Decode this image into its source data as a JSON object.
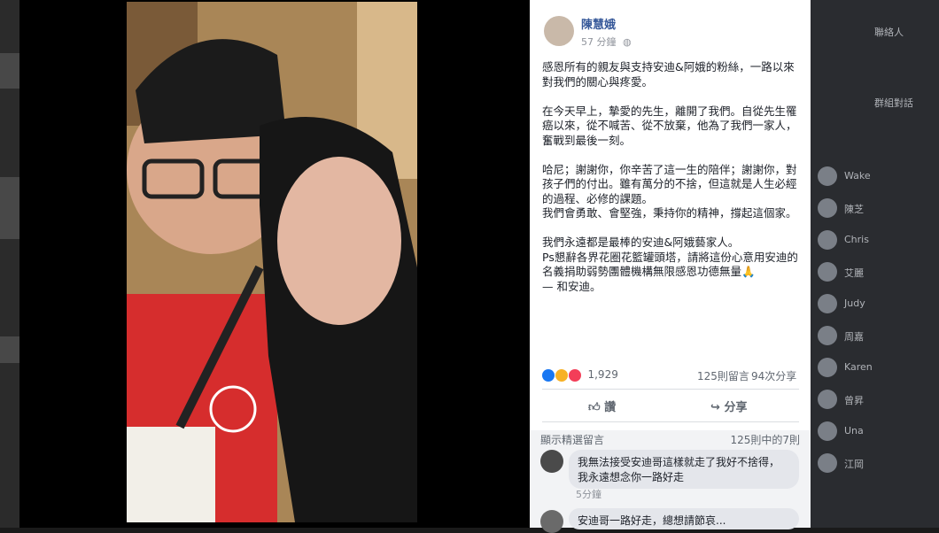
{
  "post": {
    "author": "陳慧娥",
    "time": "57 分鐘",
    "body": "感恩所有的親友與支持安迪&阿娥的粉絲，一路以來對我們的關心與疼愛。\n\n在今天早上，摯愛的先生，離開了我們。自從先生罹癌以來，從不喊苦、從不放棄，他為了我們一家人，奮戰到最後一刻。\n\n哈尼；謝謝你，你辛苦了這一生的陪伴；謝謝你，對孩子們的付出。雖有萬分的不捨，但這就是人生必經的過程、必修的課題。\n我們會勇敢、會堅強，秉持你的精神，撐起這個家。\n\n我們永遠都是最棒的安迪&阿娥藝家人。\nPs懇辭各界花圈花籃罐頭塔，請將這份心意用安迪的名義捐助弱勢團體機構無限感恩功德無量🙏\n— 和安迪。",
    "reactions_count": "1,929",
    "comments_count": "125則留言",
    "shares_count": "94次分享",
    "like_label": "讚",
    "share_label": "分享"
  },
  "comments": {
    "header_left": "顯示精選留言",
    "header_right": "125則中的7則",
    "items": [
      {
        "text": "我無法接受安迪哥這樣就走了我好不捨得， 我永遠想念你一路好走",
        "time": "5分鐘"
      },
      {
        "text": "安迪哥一路好走，總想請節哀..."
      }
    ]
  },
  "sidebar": {
    "sections": [
      "聯絡人",
      "群組對話"
    ],
    "contacts": [
      "Wake",
      "陳芝",
      "Chris",
      "艾麗",
      "Judy",
      "周嘉",
      "Karen",
      "曾昇",
      "Una",
      "江岡"
    ]
  },
  "colors": {
    "link": "#365899",
    "panel_bg": "#ffffff",
    "dark_bg": "#1a1a1a"
  }
}
